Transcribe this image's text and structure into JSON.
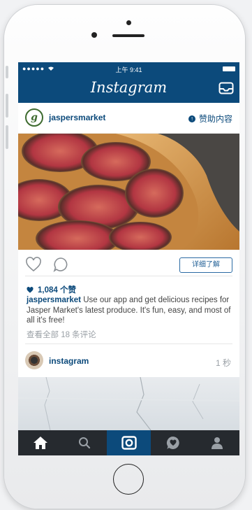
{
  "status_bar": {
    "signal": "●●●●● ",
    "time": "上午 9:41"
  },
  "app": {
    "title": "Instagram"
  },
  "post": {
    "username": "jaspersmarket",
    "sponsored_label": "赞助内容",
    "learn_more_label": "详细了解",
    "likes": "1,084 个赞",
    "caption_user": "jaspersmarket",
    "caption_text": " Use our app and get delicious recipes for Jasper Market's latest produce. It's fun, easy, and most of all it's free!",
    "view_comments": "查看全部 18 条评论"
  },
  "post2": {
    "username": "instagram",
    "time": "1 秒"
  },
  "tabs": [
    {
      "name": "home",
      "icon": "home-icon",
      "active": false
    },
    {
      "name": "search",
      "icon": "search-icon",
      "active": false
    },
    {
      "name": "camera",
      "icon": "camera-icon",
      "active": true
    },
    {
      "name": "activity",
      "icon": "activity-heart-icon",
      "active": false
    },
    {
      "name": "profile",
      "icon": "profile-icon",
      "active": false
    }
  ],
  "colors": {
    "brand": "#0c4a7b",
    "tabbar": "#262a2f",
    "link": "#1f5e95"
  }
}
